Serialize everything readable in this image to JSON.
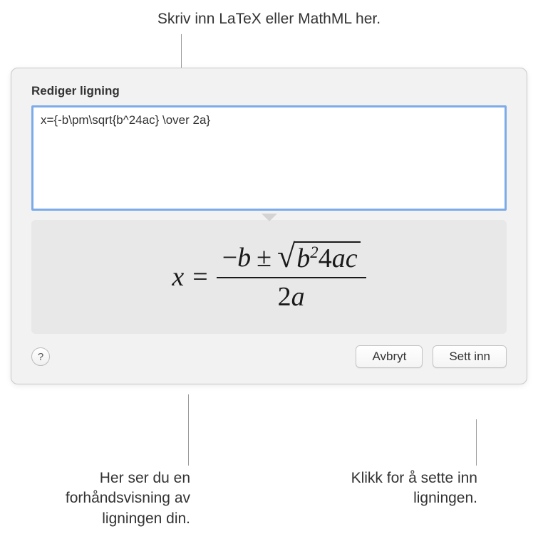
{
  "callouts": {
    "top": "Skriv inn LaTeX eller MathML her.",
    "bottom_left": "Her ser du en forhåndsvisning av ligningen din.",
    "bottom_right": "Klikk for å sette inn ligningen."
  },
  "dialog": {
    "title": "Rediger ligning",
    "input_value": "x={-b\\pm\\sqrt{b^24ac} \\over 2a}",
    "help_label": "?",
    "cancel_label": "Avbryt",
    "insert_label": "Sett inn"
  },
  "preview": {
    "lhs_var": "x",
    "equals": "=",
    "neg_b": "−b",
    "pm": "±",
    "radicand_b": "b",
    "radicand_exp": "2",
    "radicand_4ac": "4ac",
    "denominator": "2a"
  }
}
